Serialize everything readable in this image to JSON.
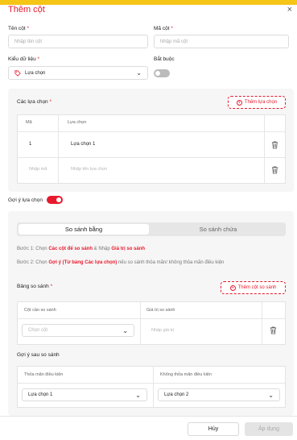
{
  "header": {
    "title": "Thêm cột",
    "close": "×"
  },
  "fields": {
    "ten_cot": {
      "label": "Tên cột",
      "placeholder": "Nhập tên cột"
    },
    "ma_cot": {
      "label": "Mã cột",
      "placeholder": "Nhập mã cột"
    },
    "kieu_du_lieu": {
      "label": "Kiểu dữ liệu",
      "value": "Lựa chọn"
    },
    "bat_buoc": {
      "label": "Bắt buộc",
      "on": false
    }
  },
  "choices": {
    "label": "Các lựa chọn",
    "add_button": "Thêm lựa chọn",
    "columns": [
      "Mã",
      "Lựa chọn"
    ],
    "rows": [
      {
        "ma": "1",
        "lua_chon": "Lựa chọn 1"
      }
    ],
    "new_row": {
      "ma_placeholder": "Nhập mã",
      "lua_chon_placeholder": "Nhập tên lựa chọn"
    }
  },
  "suggest": {
    "label": "Gợi ý lựa chọn",
    "on": true
  },
  "compare": {
    "tabs": [
      "So sánh bằng",
      "So sánh chứa"
    ],
    "active_tab": 0,
    "step1": {
      "prefix": "Bước 1: Chọn ",
      "b1": "Các cột để so sánh",
      "mid": " & Nhập ",
      "b2": "Giá trị so sánh"
    },
    "step2": {
      "prefix": "Bước 2: Chọn ",
      "b1": "Gợi ý (Từ bảng Các lựa chọn)",
      "suffix": " nếu so sánh thỏa mãn/ không thỏa mãn điều kiện"
    },
    "table": {
      "label": "Bảng so sánh",
      "add_button": "Thêm cột so sánh",
      "columns": [
        "Cột cần so sánh",
        "Giá trị so sánh"
      ],
      "row": {
        "col_placeholder": "Chọn cột",
        "val_placeholder": "Nhập giá trị"
      }
    },
    "after": {
      "label": "Gợi ý sau so sánh",
      "columns": [
        "Thỏa mãn điều kiện",
        "Không thỏa mãn điều kiện"
      ],
      "values": [
        "Lựa chọn 1",
        "Lựa chọn 2"
      ]
    }
  },
  "footer": {
    "cancel": "Hủy",
    "apply": "Áp dụng"
  },
  "colors": {
    "accent": "#e8192c",
    "top_strip": "#f5c518"
  }
}
